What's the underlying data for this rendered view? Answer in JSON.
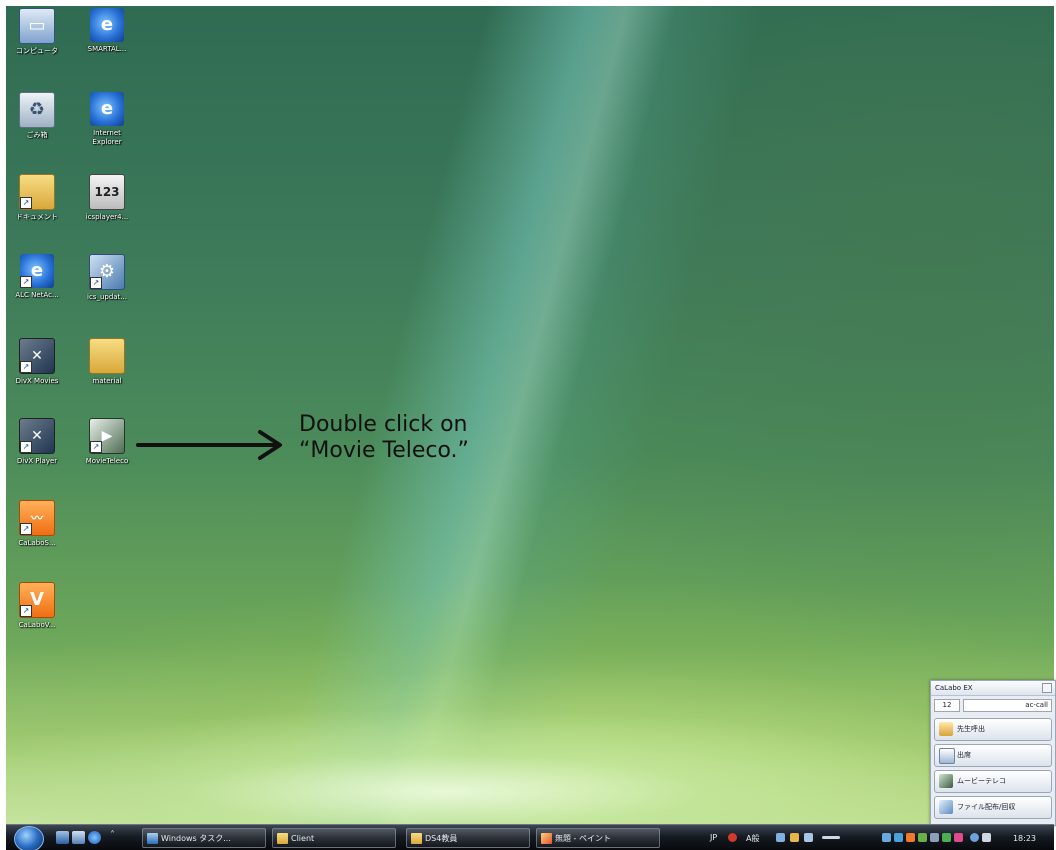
{
  "desktop": {
    "icons": [
      {
        "label": "コンピュータ",
        "icon": "computer-icon"
      },
      {
        "label": "SMARTAL...",
        "icon": "internet-explorer-icon"
      },
      {
        "label": "ごみ箱",
        "icon": "recycle-bin-icon"
      },
      {
        "label": "Internet Explorer",
        "icon": "internet-explorer-icon"
      },
      {
        "label": "ドキュメント",
        "icon": "folder-icon"
      },
      {
        "label": "icsplayer4...",
        "icon": "clapperboard-icon"
      },
      {
        "label": "ALC NetAc...",
        "icon": "internet-explorer-icon"
      },
      {
        "label": "ics_updat...",
        "icon": "setup-icon"
      },
      {
        "label": "DivX Movies",
        "icon": "divx-icon"
      },
      {
        "label": "material",
        "icon": "folder-icon"
      },
      {
        "label": "DivX Player",
        "icon": "divx-player-icon"
      },
      {
        "label": "MovieTeleco",
        "icon": "movie-teleco-icon"
      },
      {
        "label": "CaLaboS...",
        "icon": "calabo-orange-icon"
      },
      {
        "label": "CaLaboV...",
        "icon": "calabo-v-icon"
      }
    ]
  },
  "annotation": {
    "line1": "Double click on",
    "line2": "“Movie Teleco.”"
  },
  "gadget": {
    "title": "CaLabo EX",
    "field_left": "12",
    "field_right": "ac-call",
    "buttons": [
      {
        "label": "先生呼出",
        "icon": "teacher-call-icon"
      },
      {
        "label": "出席",
        "icon": "attendance-icon"
      },
      {
        "label": "ムービーテレコ",
        "icon": "movie-teleco-icon"
      },
      {
        "label": "ファイル配布/回収",
        "icon": "file-distribute-icon"
      }
    ]
  },
  "taskbar": {
    "start_icon": "windows-start-orb-icon",
    "quick_launch": [
      "show-desktop-icon",
      "switch-windows-icon",
      "internet-explorer-icon"
    ],
    "tasks": [
      {
        "label": "Windows タスク...",
        "icon": "task-manager-icon"
      },
      {
        "label": "Client",
        "icon": "folder-icon"
      },
      {
        "label": "DS4教員",
        "icon": "folder-icon"
      },
      {
        "label": "無題 - ペイント",
        "icon": "paint-icon"
      }
    ],
    "tray_language": "JP",
    "tray_ime": "A般",
    "clock": "18:23"
  },
  "colors": {
    "taskbar": "#0e1218",
    "annotation_text": "#111111",
    "gadget_bg": "#e9edf3"
  }
}
